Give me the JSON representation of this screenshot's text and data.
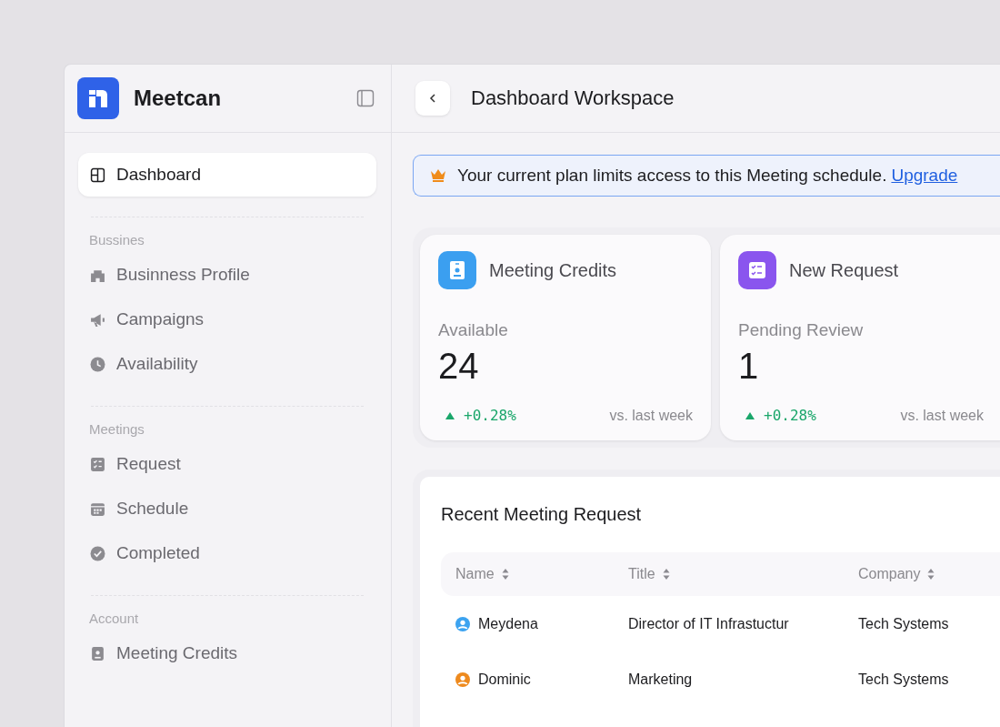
{
  "sidebar": {
    "brand": "Meetcan",
    "items": [
      {
        "label": "Dashboard",
        "kind": "grid",
        "selected": true
      }
    ],
    "sections": [
      {
        "title": "Bussines",
        "items": [
          {
            "label": "Businness Profile",
            "kind": "building",
            "selected": false
          },
          {
            "label": "Campaigns",
            "kind": "megaphone",
            "selected": false
          },
          {
            "label": "Availability",
            "kind": "clock",
            "selected": false
          }
        ]
      },
      {
        "title": "Meetings",
        "items": [
          {
            "label": "Request",
            "kind": "checklist",
            "selected": false
          },
          {
            "label": "Schedule",
            "kind": "calendar",
            "selected": false
          },
          {
            "label": "Completed",
            "kind": "check",
            "selected": false
          }
        ]
      },
      {
        "title": "Account",
        "items": [
          {
            "label": "Meeting Credits",
            "kind": "badge",
            "selected": false
          }
        ]
      }
    ]
  },
  "header": {
    "title": "Dashboard Workspace"
  },
  "banner": {
    "text": "Your current plan limits access to this Meeting schedule.",
    "link": "Upgrade"
  },
  "stats": [
    {
      "title": "Meeting Credits",
      "kind": "badge",
      "color": "#3b9ff0",
      "label": "Available",
      "value": "24",
      "change": "+0.28%",
      "compare": "vs.  last week"
    },
    {
      "title": "New Request",
      "kind": "checklist",
      "color": "#8a55ee",
      "label": "Pending Review",
      "value": "1",
      "change": "+0.28%",
      "compare": "vs.  last week"
    }
  ],
  "table": {
    "title": "Recent Meeting Request",
    "columns": [
      "Name",
      "Title",
      "Company"
    ],
    "rows": [
      {
        "name": "Meydena",
        "color": "#3ca3f0",
        "title": "Director of IT Infrastuctur",
        "company": "Tech Systems"
      },
      {
        "name": "Dominic",
        "color": "#ee8a1e",
        "title": "Marketing",
        "company": "Tech Systems"
      }
    ]
  }
}
